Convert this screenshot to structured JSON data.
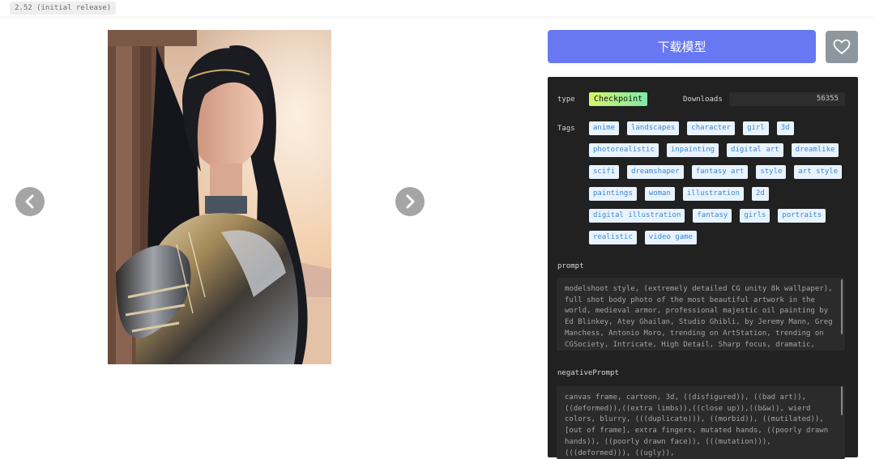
{
  "header": {
    "version_label": "2.52 (initial release)"
  },
  "gallery": {
    "image_alt": "Portrait of a woman with long dark hair in silver armor",
    "prev_icon": "chevron-left-icon",
    "next_icon": "chevron-right-icon"
  },
  "actions": {
    "download_label": "下载模型",
    "favorite_icon": "heart-outline-icon"
  },
  "details": {
    "type_label": "type",
    "type_value": "Checkpoint",
    "downloads_label": "Downloads",
    "downloads_value": "56355",
    "tags_label": "Tags",
    "tags": [
      "anime",
      "landscapes",
      "character",
      "girl",
      "3d",
      "photorealistic",
      "inpainting",
      "digital art",
      "dreamlike",
      "scifi",
      "dreamshaper",
      "fantasy art",
      "style",
      "art style",
      "paintings",
      "woman",
      "illustration",
      "2d",
      "digital illustration",
      "fantasy",
      "girls",
      "portraits",
      "realistic",
      "video game"
    ],
    "prompt_label": "prompt",
    "prompt_text": "modelshoot style, (extremely detailed CG unity 8k wallpaper), full shot body photo of the most beautiful artwork in the world, medieval armor, professional majestic oil painting by Ed Blinkey, Atey Ghailan, Studio Ghibli, by Jeremy Mann, Greg Manchess, Antonio Moro, trending on ArtStation, trending on CGSociety, Intricate, High Detail, Sharp focus, dramatic, photorealistic",
    "negative_label": "negativePrompt",
    "negative_text": "canvas frame, cartoon, 3d, ((disfigured)), ((bad art)), ((deformed)),((extra limbs)),((close up)),((b&w)), wierd colors, blurry, (((duplicate))), ((morbid)), ((mutilated)), [out of frame], extra fingers, mutated hands, ((poorly drawn hands)), ((poorly drawn face)), (((mutation))), (((deformed))), ((ugly)),"
  },
  "colors": {
    "accent": "#6878f2",
    "panel_bg": "#212121",
    "tag_bg": "#e8f3ff",
    "tag_text": "#3b87d6",
    "type_badge_start": "#d5f56c",
    "type_badge_end": "#80e8a8"
  }
}
